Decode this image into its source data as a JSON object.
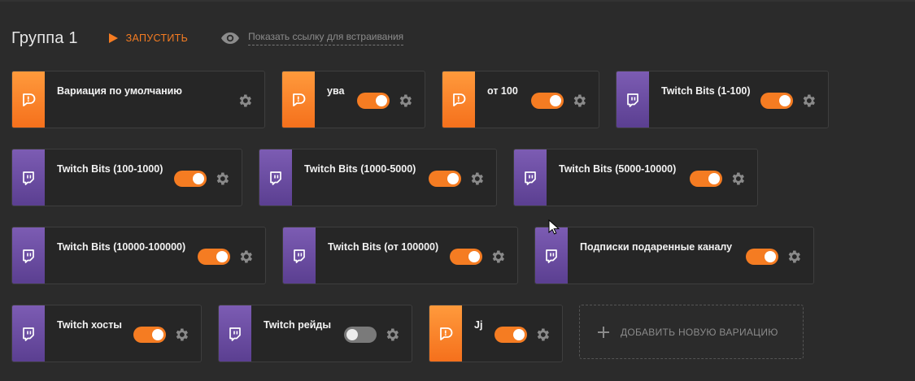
{
  "header": {
    "group_title": "Группа 1",
    "run_label": "ЗАПУСТИТЬ",
    "embed_label": "Показать ссылку для встраивания"
  },
  "colors": {
    "accent": "#f57c22",
    "donation": "#f57c22",
    "twitch": "#6441a5"
  },
  "variations": [
    {
      "name": "Вариация по умолчанию",
      "icon": "donationalerts-icon",
      "source": "donation",
      "has_toggle": false
    },
    {
      "name": "ува",
      "icon": "donationalerts-icon",
      "source": "donation",
      "enabled": true
    },
    {
      "name": "от 100",
      "icon": "donationalerts-icon",
      "source": "donation",
      "enabled": true
    },
    {
      "name": "Twitch Bits (1-100)",
      "icon": "twitch-icon",
      "source": "twitch",
      "enabled": true
    },
    {
      "name": "Twitch Bits (100-1000)",
      "icon": "twitch-icon",
      "source": "twitch",
      "enabled": true
    },
    {
      "name": "Twitch Bits (1000-5000)",
      "icon": "twitch-icon",
      "source": "twitch",
      "enabled": true
    },
    {
      "name": "Twitch Bits (5000-10000)",
      "icon": "twitch-icon",
      "source": "twitch",
      "enabled": true
    },
    {
      "name": "Twitch Bits (10000-100000)",
      "icon": "twitch-icon",
      "source": "twitch",
      "enabled": true
    },
    {
      "name": "Twitch Bits (от 100000)",
      "icon": "twitch-icon",
      "source": "twitch",
      "enabled": true
    },
    {
      "name": "Подписки подаренные каналу",
      "icon": "twitch-icon",
      "source": "twitch",
      "enabled": true
    },
    {
      "name": "Twitch хосты",
      "icon": "twitch-icon",
      "source": "twitch",
      "enabled": true
    },
    {
      "name": "Twitch рейды",
      "icon": "twitch-icon",
      "source": "twitch",
      "enabled": false
    },
    {
      "name": "Jj",
      "icon": "donationalerts-icon",
      "source": "donation",
      "enabled": true
    }
  ],
  "add_variation_label": "ДОБАВИТЬ НОВУЮ ВАРИАЦИЮ"
}
